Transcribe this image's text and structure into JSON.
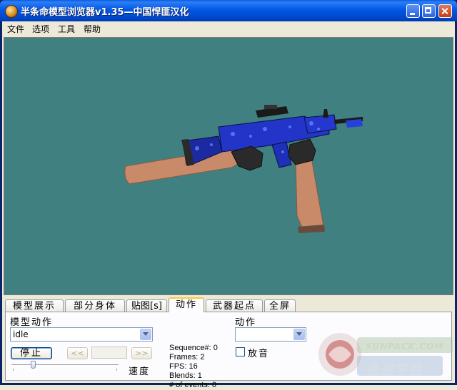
{
  "window": {
    "title": "半条命模型浏览器v1.35—中国悍匪汉化"
  },
  "menu": [
    {
      "label": "文件"
    },
    {
      "label": "选项"
    },
    {
      "label": "工具"
    },
    {
      "label": "帮助"
    }
  ],
  "tabs": [
    {
      "label": "模型展示",
      "active": false
    },
    {
      "label": "部分身体",
      "active": false
    },
    {
      "label": "贴图[s]",
      "active": false
    },
    {
      "label": "动作",
      "active": true
    },
    {
      "label": "武器起点",
      "active": false
    },
    {
      "label": "全屏",
      "active": false
    }
  ],
  "animation_panel": {
    "model_action_label": "模型动作",
    "sequence_value": "idle",
    "stop_button": "停止",
    "prev_button": "<<",
    "next_button": ">>",
    "speed_label": "速度",
    "speed_level": 0.2,
    "stats": {
      "sequence": "Sequence#: 0",
      "frames": "Frames: 2",
      "fps": "FPS: 16",
      "blends": "Blends: 1",
      "events": "# of events: 0"
    },
    "action_label": "动作",
    "action_value": "",
    "sound_label": "放音",
    "sound_checked": false
  },
  "watermark": {
    "site": "5UNPACK.COM",
    "brand": "急速下载"
  },
  "colors": {
    "viewport_bg": "#408080",
    "titlebar": "#0058E6"
  },
  "icons": [
    "app-icon",
    "minimize-icon",
    "maximize-icon",
    "close-icon",
    "chevron-down-icon"
  ]
}
